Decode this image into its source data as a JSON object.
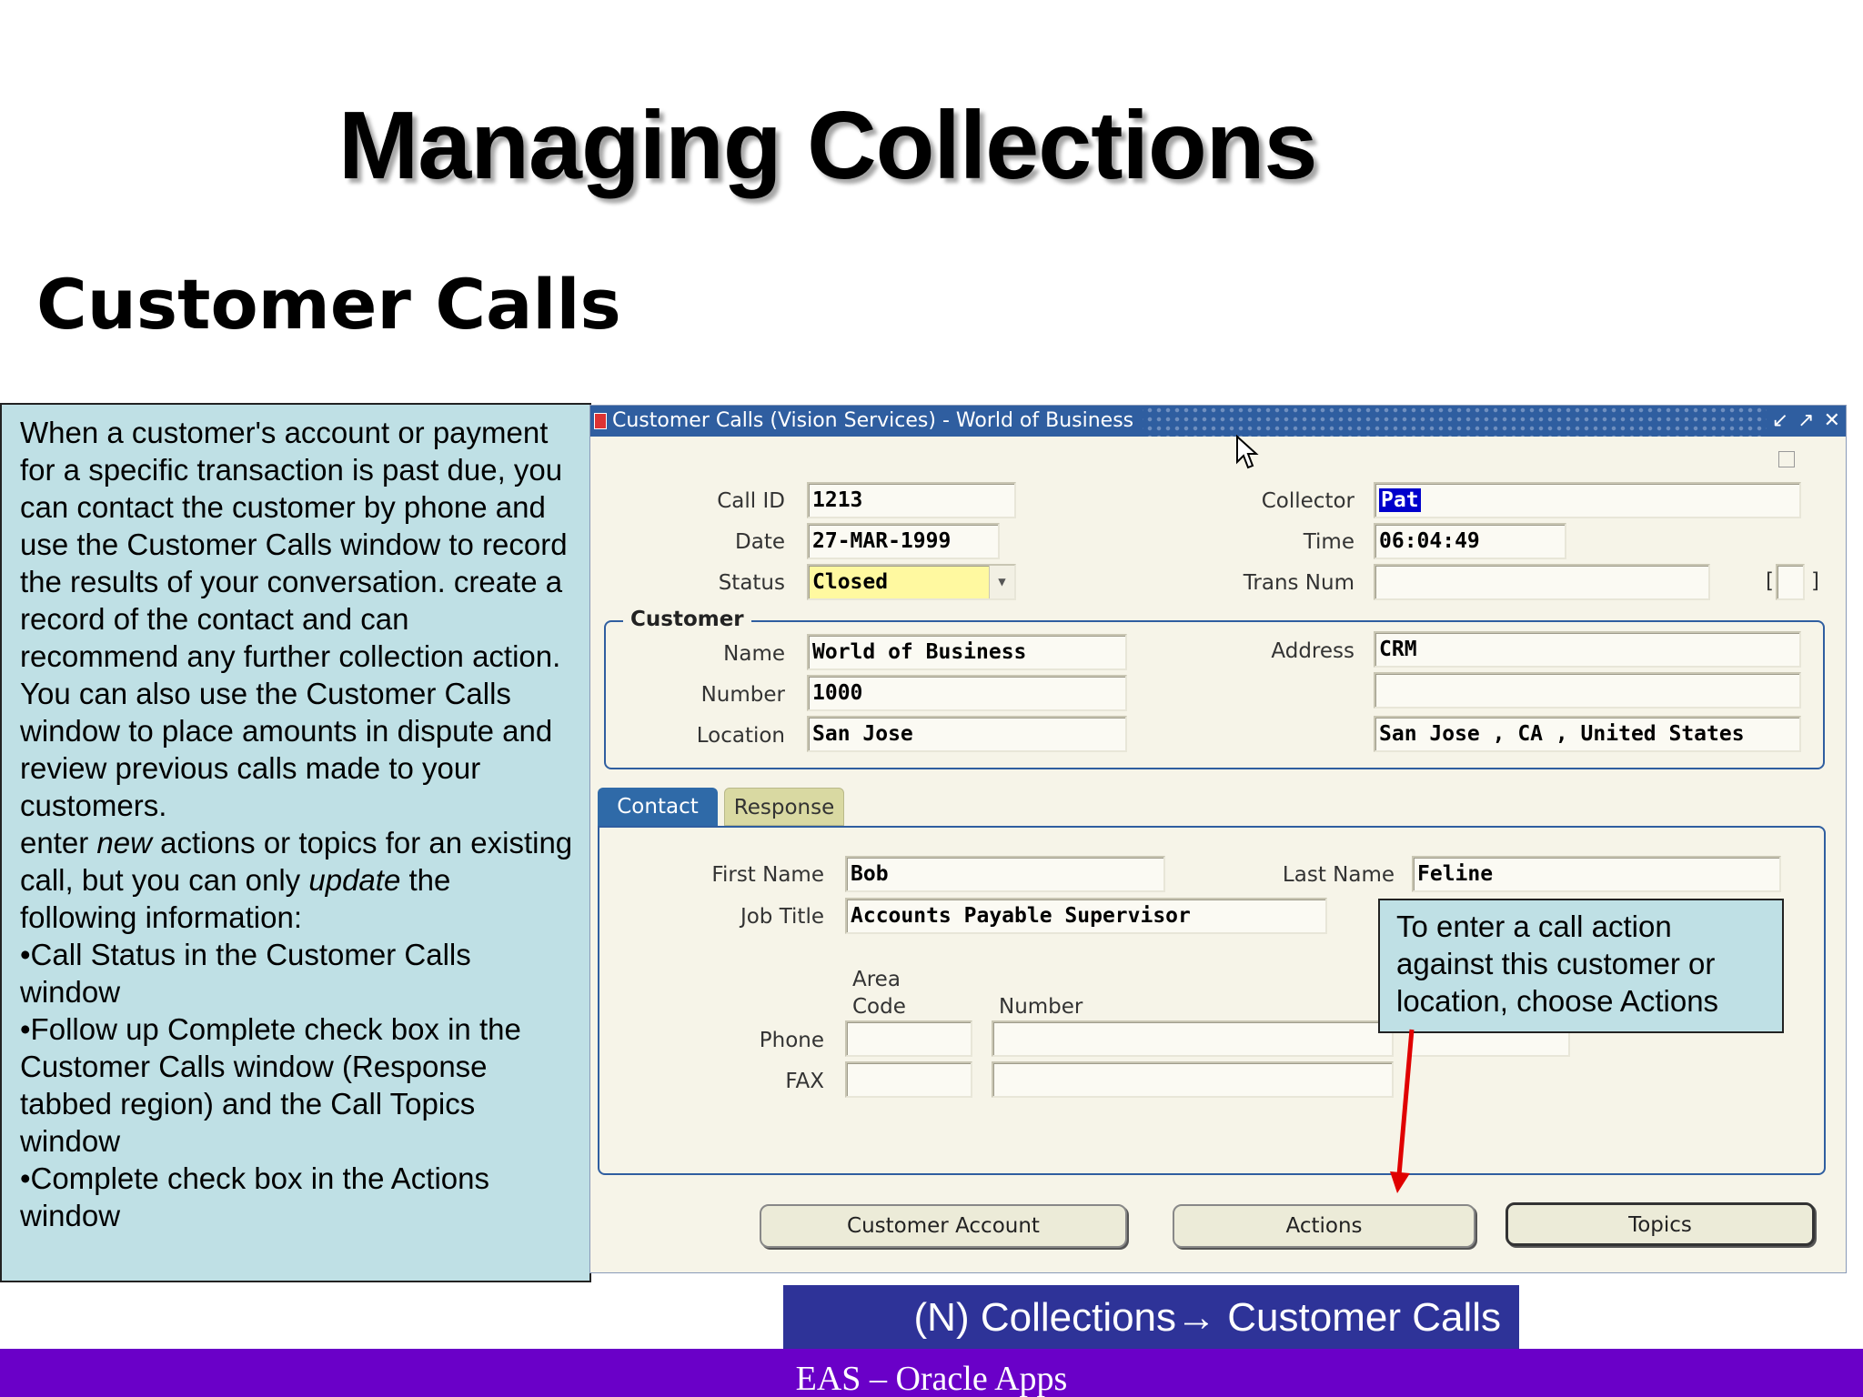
{
  "slide": {
    "title": "Managing Collections",
    "subtitle": "Customer Calls"
  },
  "note": {
    "paragraphs": [
      "When a customer's account or payment for a specific transaction is past due, you can contact the customer by phone and use the Customer Calls window to record the results of your conversation. create a record of the contact and can recommend any further collection action.",
      "You can also use the Customer Calls window to place amounts in dispute and review previous calls made to your customers."
    ],
    "update_pre": "enter ",
    "update_new": "new",
    "update_mid": " actions or topics for an existing call, but you can only ",
    "update_word": "update",
    "update_post": " the following information:",
    "bullets": [
      "•Call Status in the Customer Calls window",
      "•Follow up Complete check box in the Customer Calls window (Response tabbed region) and the Call Topics window",
      "•Complete check box in the Actions window"
    ]
  },
  "window": {
    "title": "Customer Calls (Vision Services) - World of Business",
    "controls": [
      "↙",
      "↗",
      "✕"
    ],
    "labels": {
      "call_id": "Call ID",
      "date": "Date",
      "status": "Status",
      "collector": "Collector",
      "time": "Time",
      "trans_num": "Trans Num",
      "customer_group": "Customer",
      "name": "Name",
      "number": "Number",
      "location": "Location",
      "address": "Address",
      "first_name": "First Name",
      "last_name": "Last Name",
      "job_title": "Job Title",
      "area_code_1": "Area",
      "area_code_2": "Code",
      "phone_number": "Number",
      "phone": "Phone",
      "fax": "FAX",
      "bracket_open": "[",
      "bracket_close": "]"
    },
    "values": {
      "call_id": "1213",
      "date": "27-MAR-1999",
      "status": "Closed",
      "collector": "Pat",
      "time": "06:04:49",
      "trans_num": "",
      "name": "World of Business",
      "number": "1000",
      "location": "San Jose",
      "address_line1": "CRM",
      "address_line2": "",
      "address_line3": "San Jose      , CA      , United States",
      "first_name": "Bob",
      "last_name": "Feline",
      "job_title": "Accounts Payable Supervisor",
      "phone_area": "",
      "phone_number": "",
      "fax_area": "",
      "fax_number": ""
    },
    "tabs": [
      "Contact",
      "Response"
    ],
    "buttons": {
      "customer_account": "Customer Account",
      "actions": "Actions",
      "topics": "Topics"
    }
  },
  "callout": {
    "text": "To enter a call action against this customer or location, choose Actions"
  },
  "nav_banner": {
    "text": "(N) Collections→ Customer Calls"
  },
  "footer": {
    "text": "EAS – Oracle Apps"
  },
  "colors": {
    "titlebar": "#2f5ea0",
    "note_bg": "#bfe0e5",
    "footer_bg": "#6a00c8",
    "banner_bg": "#2e3398",
    "arrow": "#e00000"
  }
}
